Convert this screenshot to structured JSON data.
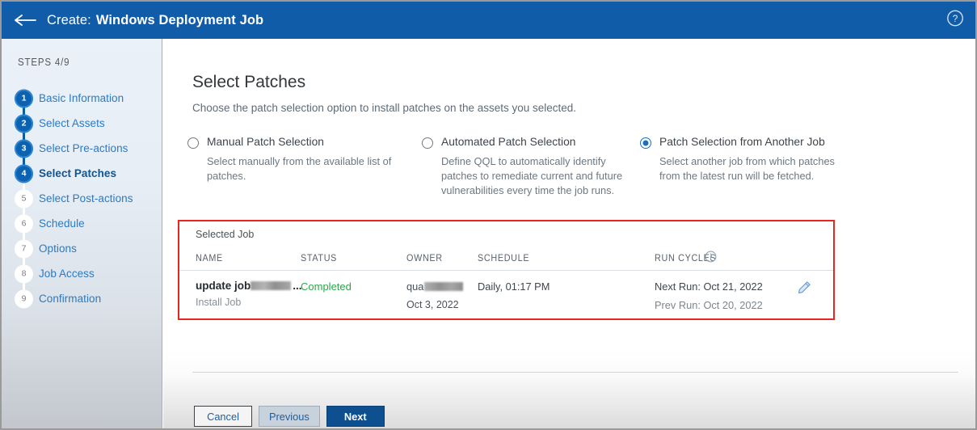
{
  "titlebar": {
    "back_icon": "back-arrow-icon",
    "prefix": "Create:",
    "title": "Windows Deployment Job",
    "help_icon": "help-circle-icon",
    "bg": "#115ca8"
  },
  "sidebar": {
    "steps_label": "STEPS 4/9",
    "current_step": 4,
    "total_steps": 9,
    "items": [
      {
        "num": "1",
        "label": "Basic Information",
        "state": "done"
      },
      {
        "num": "2",
        "label": "Select Assets",
        "state": "done"
      },
      {
        "num": "3",
        "label": "Select Pre-actions",
        "state": "done"
      },
      {
        "num": "4",
        "label": "Select Patches",
        "state": "active"
      },
      {
        "num": "5",
        "label": "Select Post-actions",
        "state": "todo"
      },
      {
        "num": "6",
        "label": "Schedule",
        "state": "todo"
      },
      {
        "num": "7",
        "label": "Options",
        "state": "todo"
      },
      {
        "num": "8",
        "label": "Job Access",
        "state": "todo"
      },
      {
        "num": "9",
        "label": "Confirmation",
        "state": "todo"
      }
    ]
  },
  "main": {
    "page_title": "Select Patches",
    "page_subtitle": "Choose the patch selection option to install patches on the assets you selected.",
    "options": [
      {
        "title": "Manual Patch Selection",
        "desc": "Select manually from the available list of patches.",
        "selected": false
      },
      {
        "title": "Automated Patch Selection",
        "desc": "Define QQL to automatically identify patches to remediate current and future vulnerabilities every time the job runs.",
        "selected": false
      },
      {
        "title": "Patch Selection from Another Job",
        "desc": "Select another job from which patches from the latest run will be fetched.",
        "selected": true
      }
    ],
    "job_panel": {
      "label": "Selected Job",
      "highlight_color": "#e8251f",
      "columns": [
        "NAME",
        "STATUS",
        "OWNER",
        "SCHEDULE",
        "RUN CYCLES"
      ],
      "run_cycles_info_icon": "info-circle-icon",
      "row": {
        "name": "update job",
        "name_ellipsis": "...",
        "name_redacted": true,
        "name_sub": "Install Job",
        "status": "Completed",
        "status_color": "#2aa94a",
        "owner": "qua",
        "owner_redacted": true,
        "owner_date": "Oct 3, 2022",
        "schedule": "Daily, 01:17 PM",
        "next_run": "Next Run: Oct 21, 2022",
        "prev_run": "Prev Run: Oct 20, 2022",
        "edit_icon": "pencil-edit-icon"
      }
    },
    "footer": {
      "cancel": "Cancel",
      "previous": "Previous",
      "next": "Next"
    }
  }
}
